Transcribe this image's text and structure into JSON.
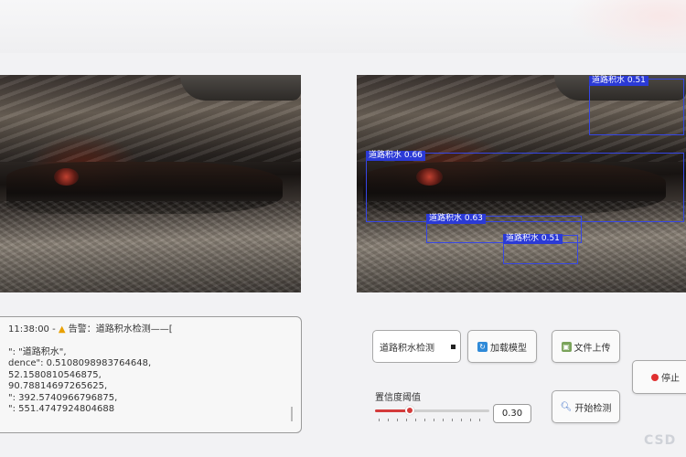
{
  "log": {
    "line1_time": "11:38:00 -",
    "line1_alert": "告警：道路积水检测——[",
    "rows": [
      "\": \"道路积水\",",
      "dence\": 0.5108098983764648,",
      "52.1580810546875,",
      "90.78814697265625,",
      "\": 392.5740966796875,",
      "\": 551.4747924804688"
    ]
  },
  "detections": [
    {
      "label": "道路积水 0.51"
    },
    {
      "label": "道路积水 0.66"
    },
    {
      "label": "道路积水 0.63"
    },
    {
      "label": "道路积水 0.51"
    }
  ],
  "controls": {
    "task_select_value": "道路积水检测",
    "load_model_label": "加载模型",
    "upload_file_label": "文件上传",
    "start_detect_label": "开始检测",
    "stop_label": "停止",
    "confidence_label": "置信度阈值",
    "confidence_value": "0.30",
    "confidence_fraction": 0.3
  },
  "watermark": "CSD",
  "colors": {
    "detection_box": "#3646e6",
    "slider_accent": "#d43b3b",
    "stop_dot": "#e03030"
  }
}
